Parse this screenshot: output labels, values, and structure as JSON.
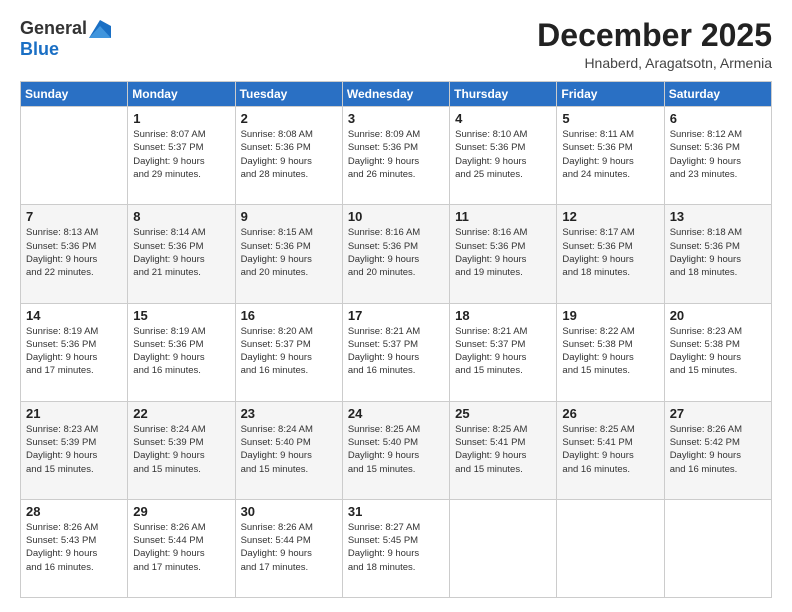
{
  "logo": {
    "general": "General",
    "blue": "Blue"
  },
  "title": "December 2025",
  "location": "Hnaberd, Aragatsotn, Armenia",
  "weekdays": [
    "Sunday",
    "Monday",
    "Tuesday",
    "Wednesday",
    "Thursday",
    "Friday",
    "Saturday"
  ],
  "weeks": [
    [
      {
        "day": "",
        "info": ""
      },
      {
        "day": "1",
        "info": "Sunrise: 8:07 AM\nSunset: 5:37 PM\nDaylight: 9 hours\nand 29 minutes."
      },
      {
        "day": "2",
        "info": "Sunrise: 8:08 AM\nSunset: 5:36 PM\nDaylight: 9 hours\nand 28 minutes."
      },
      {
        "day": "3",
        "info": "Sunrise: 8:09 AM\nSunset: 5:36 PM\nDaylight: 9 hours\nand 26 minutes."
      },
      {
        "day": "4",
        "info": "Sunrise: 8:10 AM\nSunset: 5:36 PM\nDaylight: 9 hours\nand 25 minutes."
      },
      {
        "day": "5",
        "info": "Sunrise: 8:11 AM\nSunset: 5:36 PM\nDaylight: 9 hours\nand 24 minutes."
      },
      {
        "day": "6",
        "info": "Sunrise: 8:12 AM\nSunset: 5:36 PM\nDaylight: 9 hours\nand 23 minutes."
      }
    ],
    [
      {
        "day": "7",
        "info": "Sunrise: 8:13 AM\nSunset: 5:36 PM\nDaylight: 9 hours\nand 22 minutes."
      },
      {
        "day": "8",
        "info": "Sunrise: 8:14 AM\nSunset: 5:36 PM\nDaylight: 9 hours\nand 21 minutes."
      },
      {
        "day": "9",
        "info": "Sunrise: 8:15 AM\nSunset: 5:36 PM\nDaylight: 9 hours\nand 20 minutes."
      },
      {
        "day": "10",
        "info": "Sunrise: 8:16 AM\nSunset: 5:36 PM\nDaylight: 9 hours\nand 20 minutes."
      },
      {
        "day": "11",
        "info": "Sunrise: 8:16 AM\nSunset: 5:36 PM\nDaylight: 9 hours\nand 19 minutes."
      },
      {
        "day": "12",
        "info": "Sunrise: 8:17 AM\nSunset: 5:36 PM\nDaylight: 9 hours\nand 18 minutes."
      },
      {
        "day": "13",
        "info": "Sunrise: 8:18 AM\nSunset: 5:36 PM\nDaylight: 9 hours\nand 18 minutes."
      }
    ],
    [
      {
        "day": "14",
        "info": "Sunrise: 8:19 AM\nSunset: 5:36 PM\nDaylight: 9 hours\nand 17 minutes."
      },
      {
        "day": "15",
        "info": "Sunrise: 8:19 AM\nSunset: 5:36 PM\nDaylight: 9 hours\nand 16 minutes."
      },
      {
        "day": "16",
        "info": "Sunrise: 8:20 AM\nSunset: 5:37 PM\nDaylight: 9 hours\nand 16 minutes."
      },
      {
        "day": "17",
        "info": "Sunrise: 8:21 AM\nSunset: 5:37 PM\nDaylight: 9 hours\nand 16 minutes."
      },
      {
        "day": "18",
        "info": "Sunrise: 8:21 AM\nSunset: 5:37 PM\nDaylight: 9 hours\nand 15 minutes."
      },
      {
        "day": "19",
        "info": "Sunrise: 8:22 AM\nSunset: 5:38 PM\nDaylight: 9 hours\nand 15 minutes."
      },
      {
        "day": "20",
        "info": "Sunrise: 8:23 AM\nSunset: 5:38 PM\nDaylight: 9 hours\nand 15 minutes."
      }
    ],
    [
      {
        "day": "21",
        "info": "Sunrise: 8:23 AM\nSunset: 5:39 PM\nDaylight: 9 hours\nand 15 minutes."
      },
      {
        "day": "22",
        "info": "Sunrise: 8:24 AM\nSunset: 5:39 PM\nDaylight: 9 hours\nand 15 minutes."
      },
      {
        "day": "23",
        "info": "Sunrise: 8:24 AM\nSunset: 5:40 PM\nDaylight: 9 hours\nand 15 minutes."
      },
      {
        "day": "24",
        "info": "Sunrise: 8:25 AM\nSunset: 5:40 PM\nDaylight: 9 hours\nand 15 minutes."
      },
      {
        "day": "25",
        "info": "Sunrise: 8:25 AM\nSunset: 5:41 PM\nDaylight: 9 hours\nand 15 minutes."
      },
      {
        "day": "26",
        "info": "Sunrise: 8:25 AM\nSunset: 5:41 PM\nDaylight: 9 hours\nand 16 minutes."
      },
      {
        "day": "27",
        "info": "Sunrise: 8:26 AM\nSunset: 5:42 PM\nDaylight: 9 hours\nand 16 minutes."
      }
    ],
    [
      {
        "day": "28",
        "info": "Sunrise: 8:26 AM\nSunset: 5:43 PM\nDaylight: 9 hours\nand 16 minutes."
      },
      {
        "day": "29",
        "info": "Sunrise: 8:26 AM\nSunset: 5:44 PM\nDaylight: 9 hours\nand 17 minutes."
      },
      {
        "day": "30",
        "info": "Sunrise: 8:26 AM\nSunset: 5:44 PM\nDaylight: 9 hours\nand 17 minutes."
      },
      {
        "day": "31",
        "info": "Sunrise: 8:27 AM\nSunset: 5:45 PM\nDaylight: 9 hours\nand 18 minutes."
      },
      {
        "day": "",
        "info": ""
      },
      {
        "day": "",
        "info": ""
      },
      {
        "day": "",
        "info": ""
      }
    ]
  ]
}
